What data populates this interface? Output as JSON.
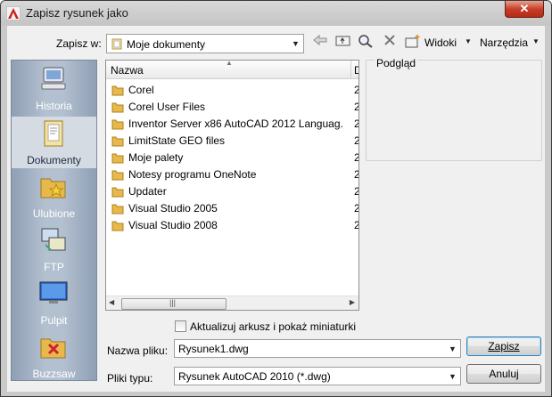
{
  "window": {
    "title": "Zapisz rysunek jako"
  },
  "toolbar": {
    "look_in_label": "Zapisz w:",
    "look_in_value": "Moje dokumenty",
    "views_label": "Widoki",
    "tools_label": "Narzędzia"
  },
  "places": [
    {
      "label": "Historia",
      "icon": "history-icon"
    },
    {
      "label": "Dokumenty",
      "icon": "documents-icon"
    },
    {
      "label": "Ulubione",
      "icon": "favorites-icon"
    },
    {
      "label": "FTP",
      "icon": "ftp-icon"
    },
    {
      "label": "Pulpit",
      "icon": "desktop-icon"
    },
    {
      "label": "Buzzsaw",
      "icon": "buzzsaw-icon"
    }
  ],
  "filelist": {
    "col_name": "Nazwa",
    "col_second": "D",
    "items": [
      {
        "name": "Corel",
        "col2": "2"
      },
      {
        "name": "Corel User Files",
        "col2": "2"
      },
      {
        "name": "Inventor Server x86 AutoCAD 2012 Languag...",
        "col2": "2"
      },
      {
        "name": "LimitState GEO files",
        "col2": "2"
      },
      {
        "name": "Moje palety",
        "col2": "2"
      },
      {
        "name": "Notesy programu OneNote",
        "col2": "2"
      },
      {
        "name": "Updater",
        "col2": "2"
      },
      {
        "name": "Visual Studio 2005",
        "col2": "2"
      },
      {
        "name": "Visual Studio 2008",
        "col2": "2"
      }
    ]
  },
  "preview": {
    "label": "Podgląd"
  },
  "options": {
    "update_thumbs_label": "Aktualizuj arkusz i pokaż miniaturki"
  },
  "filename": {
    "label": "Nazwa pliku:",
    "value": "Rysunek1.dwg"
  },
  "filetype": {
    "label": "Pliki typu:",
    "value": "Rysunek AutoCAD 2010 (*.dwg)"
  },
  "buttons": {
    "save": "Zapisz",
    "cancel": "Anuluj"
  },
  "colors": {
    "places_bg": "#b3c0d0",
    "folder": "#e8b84a",
    "close": "#c7402a"
  }
}
